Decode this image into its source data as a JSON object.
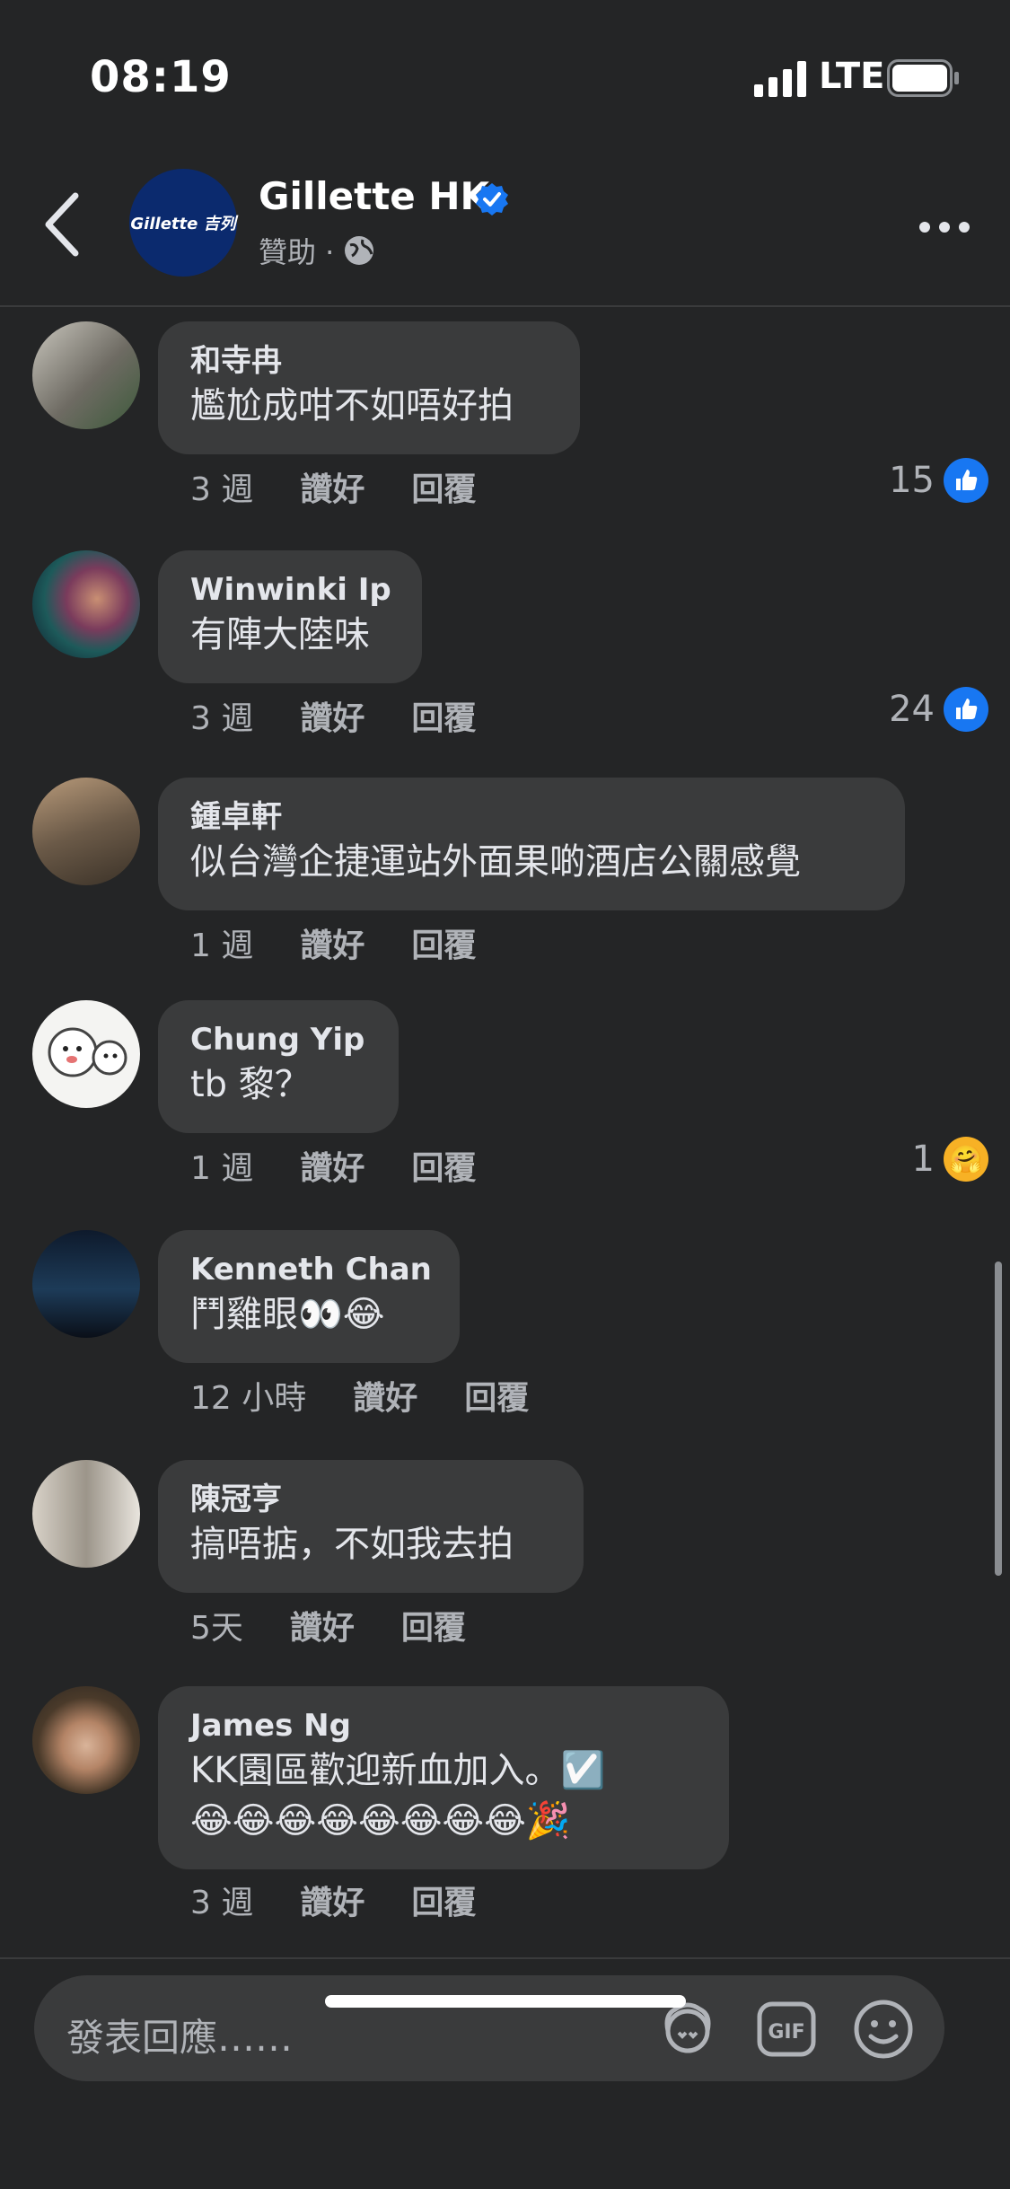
{
  "status_bar": {
    "time": "08:19",
    "network": "LTE"
  },
  "header": {
    "page_name": "Gillette HK",
    "sponsored_label": "贊助 ·",
    "avatar_text": "Gillette 吉列"
  },
  "comments": [
    {
      "author": "和寺冉",
      "text": "尷尬成咁不如唔好拍",
      "time": "3 週",
      "like_label": "讚好",
      "reply_label": "回覆",
      "reaction_count": "15",
      "reaction": "like"
    },
    {
      "author": "Winwinki Ip",
      "text": "有陣大陸味",
      "time": "3 週",
      "like_label": "讚好",
      "reply_label": "回覆",
      "reaction_count": "24",
      "reaction": "like"
    },
    {
      "author": "鍾卓軒",
      "text": "似台灣企捷運站外面果啲酒店公關感覺",
      "time": "1 週",
      "like_label": "讚好",
      "reply_label": "回覆"
    },
    {
      "author": "Chung Yip",
      "text": "tb 黎？",
      "time": "1 週",
      "like_label": "讚好",
      "reply_label": "回覆",
      "reaction_count": "1",
      "reaction": "care"
    },
    {
      "author": "Kenneth Chan",
      "text": "鬥雞眼👀😂",
      "time": "12 小時",
      "like_label": "讚好",
      "reply_label": "回覆"
    },
    {
      "author": "陳冠亨",
      "text": "搞唔掂，不如我去拍",
      "time": "5天",
      "like_label": "讚好",
      "reply_label": "回覆"
    },
    {
      "author": "James Ng",
      "text": "KK園區歡迎新血加入。☑️",
      "text2": "😂😂😂😂😂😂😂😂🎉",
      "time": "3 週",
      "like_label": "讚好",
      "reply_label": "回覆"
    }
  ],
  "composer": {
    "placeholder": "發表回應……",
    "gif_label": "GIF"
  },
  "colors": {
    "accent": "#1877f2",
    "bubble": "#3a3b3c",
    "background": "#242526"
  }
}
